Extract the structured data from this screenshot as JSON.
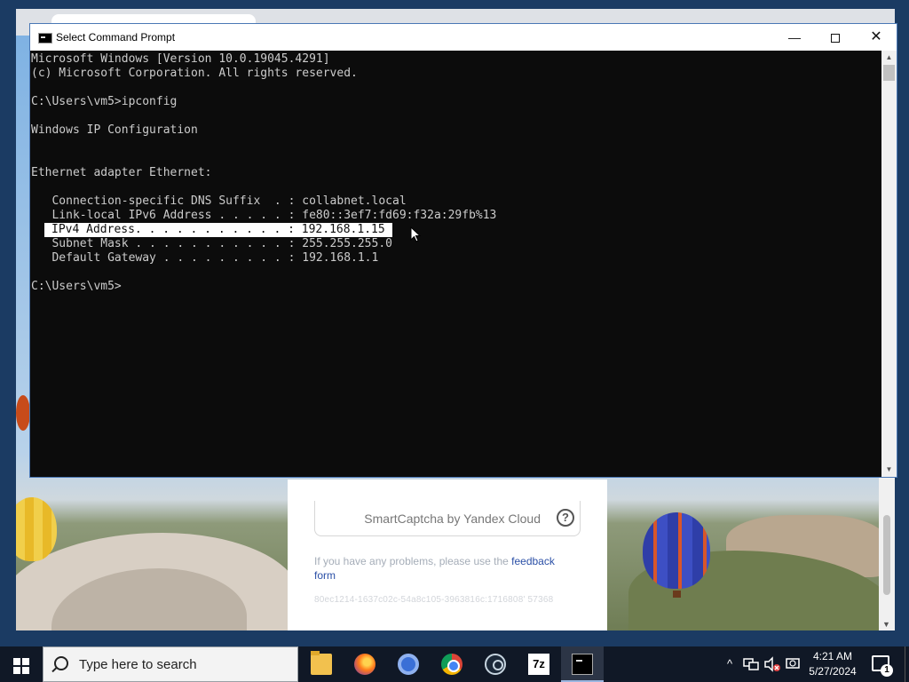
{
  "window": {
    "title": "Select Command Prompt",
    "minimize_glyph": "—",
    "close_glyph": "✕"
  },
  "console": {
    "lines": [
      "Microsoft Windows [Version 10.0.19045.4291]",
      "(c) Microsoft Corporation. All rights reserved.",
      "",
      "C:\\Users\\vm5>ipconfig",
      "",
      "Windows IP Configuration",
      "",
      "",
      "Ethernet adapter Ethernet:",
      "",
      "   Connection-specific DNS Suffix  . : collabnet.local",
      "   Link-local IPv6 Address . . . . . : fe80::3ef7:fd69:f32a:29fb%13",
      "IPv4 Address. . . . . . . . . . . : 192.168.1.15",
      "   Subnet Mask . . . . . . . . . . . : 255.255.255.0",
      "   Default Gateway . . . . . . . . . : 192.168.1.1",
      "",
      "C:\\Users\\vm5>"
    ],
    "selected_line_index": 12
  },
  "captcha": {
    "brand": "SmartCaptcha by Yandex Cloud",
    "help_glyph": "?",
    "problems_text": "If you have any problems, please use the ",
    "feedback_link": "feedback form",
    "request_id": "80ec1214-1637c02c-54a8c105-3963816c:1716808' 57368"
  },
  "taskbar": {
    "search_placeholder": "Type here to search",
    "zip_label": "7z",
    "time": "4:21 AM",
    "date": "5/27/2024",
    "notification_count": "1",
    "tray_chevron": "^"
  },
  "colors": {
    "console_bg": "#0c0c0c",
    "console_fg": "#cccccc",
    "taskbar_bg": "#101826",
    "selection_bg": "#ffffff"
  }
}
